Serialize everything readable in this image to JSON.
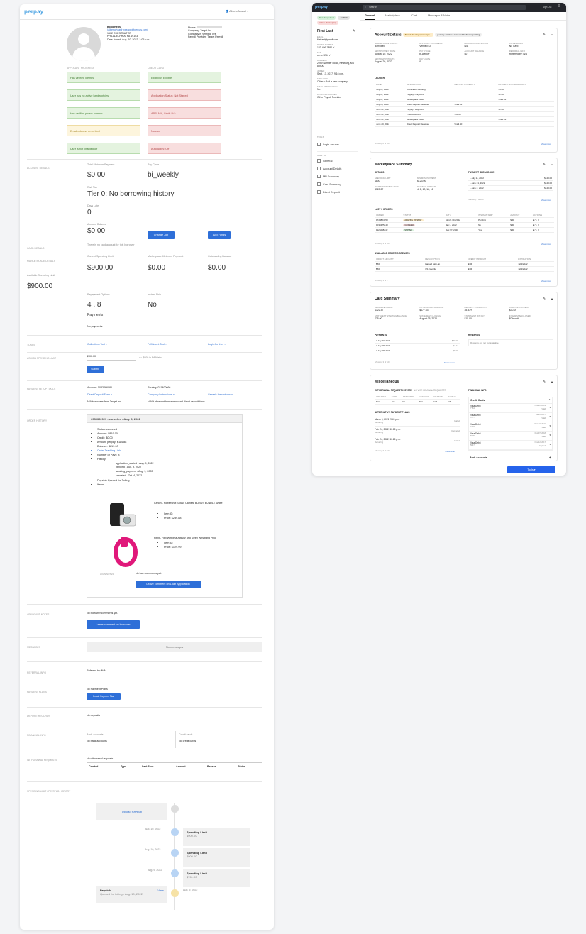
{
  "left": {
    "logo": "perpay",
    "user": "Alberto Amaral",
    "profile": {
      "name": "Bobo Reds",
      "email": "(alberto+card+preapp@perpay.com)",
      "address1": "1502 CHESTNUT ST",
      "address2": "PHILADELPHIA, PA 19103",
      "joined": "Date Joined: Aug. 10, 2022, 1:05 p.m.",
      "phone_label": "Phone:",
      "company": "Company: Target Inc",
      "company_verified": "Company is Verified: yes",
      "payroll": "Payroll Provider: Target Payroll"
    },
    "applicant_progress_label": "APPLICANT PROGRESS",
    "credit_card_label": "CREDIT CARD",
    "checks_left": [
      "Has verified identity",
      "User has no active bankruptcies",
      "Has verified phone number",
      "Email address unverified",
      "User is not charged off"
    ],
    "checks_right": [
      "Eligibility: Eligible",
      "Application Status: Not Started",
      "APR: N/A, Limit: N/A",
      "No card",
      "Auto Apply: Off"
    ],
    "account_details_label": "ACCOUNT DETAILS",
    "total_min_payment_label": "Total Minimum Payment",
    "total_min_payment": "$0.00",
    "pay_cycle_label": "Pay Cycle",
    "pay_cycle": "bi_weekly",
    "risk_tier_label": "Risk Tier",
    "risk_tier": "Tier 0: No borrowing history",
    "days_late_label": "Days Late",
    "days_late": "0",
    "account_balance_label": "Account Balance",
    "account_balance": "$0.00",
    "change_job": "Change Job",
    "add_funds": "Add Funds",
    "card_details_label": "CARD DETAILS",
    "card_details_text": "There is no card account for this borrower",
    "marketplace_label": "MARKETPLACE DETAILS",
    "available_spending_label": "Available Spending Limit",
    "available_spending": "$900.00",
    "current_spending_label": "Current Spending Limit",
    "current_spending": "$900.00",
    "mp_min_payment_label": "Marketplace Minimum Payment",
    "mp_min_payment": "$0.00",
    "outstanding_label": "Outstanding Balance",
    "outstanding": "$0.00",
    "repayment_label": "Repayment Options",
    "repayment": "4 , 8",
    "payments_label": "Payments",
    "instant_ship_label": "Instant Ship",
    "instant_ship": "No",
    "no_payments": "No payments.",
    "tools_label": "TOOLS",
    "tools": [
      "Collections Tool »",
      "Fulfillment Tool »",
      "Login As User »"
    ],
    "assign_limit_label": "ASSIGN SPENDING LIMIT",
    "limit_value": "$900.00",
    "limit_note": "<= $900 in PA/Idaho",
    "submit": "Submit",
    "payment_setup_label": "PAYMENT SETUP TOOLS",
    "account_no": "Account: 5083466086",
    "routing_no": "Routing: 021400666",
    "setup_links": [
      "Direct Deposit Form »",
      "Company Instructions »",
      "Generic Instructions »"
    ],
    "setup_note1": "N/A borrowers from Target Inc.",
    "setup_note2": "N/A% of recent borrowers used direct deposit form",
    "order_history_label": "ORDER HISTORY",
    "order": {
      "title": "#935352029 - canceled - Aug. 9, 2022",
      "lines": [
        "Status: canceled",
        "Amount: $819.00",
        "Credit: $0.00",
        "Amount perpay: $114.88",
        "Balance: $819.00"
      ],
      "link": "Order Tracking Link",
      "pays": "Number of Pays: 8",
      "history": "History:",
      "hist_items": [
        "application_started - Aug. 9, 2022",
        "pending - Aug. 9, 2022",
        "awaiting_payment - Aug. 9, 2022",
        "canceled - Oct. 4, 2022"
      ],
      "paystub": "Paystub Queued for Tolling",
      "items_label": "Items:",
      "item1": "Canon - PowerShot SX610 Camera BONUS BUNDLE White",
      "item1_id": "Item ID:",
      "item1_price": "Price: $289.88",
      "item2": "Fitbit - Flex Wireless Activity and Sleep Wristband Pink",
      "item2_id": "Item ID:",
      "item2_price": "Price: $129.99",
      "loan_notes_label": "LOAN NOTES",
      "loan_notes": "No loan comments yet.",
      "leave_loan": "Leave comment on Loan Application"
    },
    "applicant_notes_label": "APPLICANT NOTES",
    "applicant_notes": "No borrower comments yet.",
    "leave_borrower": "Leave comment on borrower",
    "messages_label": "MESSAGES",
    "no_messages": "No messages",
    "referral_label": "REFERRAL INFO",
    "referral": "Referred by: N/A",
    "payment_plans_label": "PAYMENT PLANS",
    "payment_plans": "No Payment Plans",
    "create_plan": "Create Payment Plan",
    "deposit_label": "DEPOSIT RECORDS",
    "deposits": "No deposits",
    "financial_label": "FINANCIAL INFO",
    "bank_accounts_label": "Bank accounts",
    "bank_accounts": "No bank accounts",
    "credit_cards_label": "Credit cards",
    "credit_cards": "No credit cards",
    "withdrawal_label": "WITHDRAWAL REQUESTS",
    "withdrawal": "No withdrawal requests",
    "wcols": [
      "Created",
      "Type",
      "Last Four",
      "Amount",
      "Reason",
      "Status"
    ],
    "history_label": "SPENDING LIMIT / PAYSTUB HISTORY",
    "upload_paystub": "Upload Paystub",
    "timeline": [
      {
        "date": "Aug. 10, 2022",
        "title": "Spending Limit",
        "value": "$900.00"
      },
      {
        "date": "Aug. 10, 2022",
        "title": "Spending Limit",
        "value": "$900.00"
      },
      {
        "date": "Aug. 9, 2022",
        "title": "Spending Limit",
        "value": "$761.00"
      }
    ],
    "paystub_card": {
      "title": "Paystub",
      "view": "View",
      "sub": "Queued for tolling - Aug. 10, 2022",
      "date": "Aug. 9, 2022"
    }
  },
  "right": {
    "logo": "perpay",
    "search": "Search",
    "signout": "Sign Out",
    "badges": [
      "Not charged off",
      "ACTIVE",
      "Active Bankruptcy"
    ],
    "name": "First Last",
    "side_fields": [
      {
        "label": "EMAIL",
        "value": "firstlast@gmail.com"
      },
      {
        "label": "PHONE NUMBER",
        "value": "123-456-7890 ✓"
      },
      {
        "label": "SSN",
        "value": "•••-••-1234 ✓"
      },
      {
        "label": "ADDRESS",
        "value": "2099 Number Road, Newburg, MD 85900"
      },
      {
        "label": "JOINED",
        "value": "Sept. 17, 2017, 9:16 p.m."
      },
      {
        "label": "EMPLOYER",
        "value": "Other > Add a new company"
      },
      {
        "label": "EMAIL VERIFICATION",
        "value": "No"
      },
      {
        "label": "PAYROLL PROVIDER",
        "value": "Other Payroll Provider"
      }
    ],
    "tools_label": "TOOLS",
    "login_user": "Login as user",
    "jump_label": "JUMP TO",
    "jump": [
      "General",
      "Account Details",
      "MP Summary",
      "Card Summary",
      "Direct Deposit"
    ],
    "tabs": [
      "General",
      "Marketplace",
      "Card",
      "Messages & Notes"
    ],
    "acct": {
      "title": "Account Details",
      "tier": "Tier 4: Good payer steps 1",
      "note": "perpay+ status: canceled before reporting",
      "fields": [
        [
          "MARKETPLACE STATUS",
          "Borrowed"
        ],
        [
          "APPLICANT PROGRESS",
          "Verified ID"
        ],
        [
          "BANK ACCOUNT STATUS",
          "N/A"
        ],
        [
          "CC REWARDS",
          "No Card"
        ],
        [
          "NEXT PAYMENT DATE",
          "August 10, 2022"
        ],
        [
          "PAY CYCLE",
          "bi-weekly"
        ],
        [
          "ACCOUNT BALANCE",
          "$0"
        ],
        [
          "REFERRAL INFO",
          "Referred by: N/A"
        ],
        [
          "NEXT DEPOSIT DATE",
          "August 20, 2022"
        ],
        [
          "DAYS LATE",
          "0"
        ]
      ],
      "ledger": "LEDGER",
      "lcols": [
        "DATE",
        "DESCRIPTION",
        "DEPOSITS/CREDITS",
        "PAYMENTS/WITHDRAWALS"
      ],
      "rows": [
        [
          "July 12, 2022",
          "Withdrawal Pending",
          "",
          "$3.00"
        ],
        [
          "July 11, 2022",
          "Paypay+ Payment",
          "",
          "$2.00"
        ],
        [
          "July 11, 2022",
          "Marketplace Order",
          "",
          "$123.92"
        ],
        [
          "July 10, 2022",
          "Direct Deposit Received",
          "$123.91",
          ""
        ],
        [
          "June 21, 2022",
          "Perpay+ Payment",
          "",
          "$2.00"
        ],
        [
          "June 21, 2022",
          "Product Refund",
          "$50.00",
          ""
        ],
        [
          "June 21, 2022",
          "Marketplace Order",
          "",
          "$123.63"
        ],
        [
          "June 20, 2022",
          "Direct Deposit Received",
          "$123.60",
          ""
        ]
      ],
      "showing": "Showing 8 of 100",
      "more": "Show more"
    },
    "mp": {
      "title": "Marketplace Summary",
      "details": "DETAILS",
      "fields": [
        [
          "SPENDING LIMIT",
          "$800"
        ],
        [
          "MINIMUM PAYMENT",
          "$123.00"
        ],
        [
          "OUTSTANDING BALANCE",
          "$328.27"
        ],
        [
          "PAYMENT OPTIONS",
          "4, 8, 12, 16, 18"
        ]
      ],
      "breakdown": "PAYMENT BREAKDOWN",
      "bd": [
        [
          "July 11, 2022",
          "$123.00"
        ],
        [
          "June 21, 2022",
          "$123.00"
        ],
        [
          "June 2, 2022",
          "$123.00"
        ]
      ],
      "bd_showing": "Showing 3 of 100",
      "bd_more": "Show more",
      "orders_label": "LAST 3 ORDERS",
      "ocols": [
        "ORDER",
        "STATUS",
        "DATE",
        "INSTANT SHIP",
        "AMOUNT",
        "ACTIONS"
      ],
      "orders": [
        [
          "1723824353",
          "AWAITING_PAYMENT",
          "March 30, 2022",
          "Pending",
          "$30"
        ],
        [
          "1036375443",
          "CANCELED",
          "Jan 6, 2022",
          "No",
          "$30"
        ],
        [
          "1125098442",
          "SHIPPED",
          "Dec 27, 2020",
          "Yes",
          "$30"
        ]
      ],
      "o_showing": "Showing 3 of 100",
      "o_more": "Show more",
      "credits_label": "AVAILABLE CREDIT/DISPENSES",
      "ccols": [
        "CREDIT AMOUNT",
        "DESCRIPTION",
        "CREDIT MINIMUM",
        "EXPIRATION"
      ],
      "credits": [
        [
          "$50",
          "Lapsed Sign-up",
          "$400",
          "12/3/2022"
        ],
        [
          "$50",
          "CS Favorite",
          "$400",
          "12/3/2022"
        ]
      ],
      "c_showing": "Showing 1 of 1",
      "c_more": "Show more"
    },
    "card": {
      "title": "Card Summary",
      "fields": [
        [
          "AVAILABLE CREDIT",
          "$322.37"
        ],
        [
          "OUTSTANDING BALANCE",
          "$177.63"
        ],
        [
          "PERCENT UTILIZATION",
          "35.53%"
        ],
        [
          "CARD MIN PAYMENT",
          "$30.00"
        ],
        [
          "STATEMENT STARTING BALANCE",
          "$25.00"
        ],
        [
          "STATEMENT CLOSING",
          "August 05, 2022"
        ],
        [
          "STATEMENT MIN PAY",
          "$15.00"
        ],
        [
          "INTEREST/ENCLOSED",
          "$0/month"
        ]
      ],
      "payments_label": "PAYMENTS",
      "payments": [
        [
          "July 20, 2022",
          "$50.00"
        ],
        [
          "July 18, 2022",
          "$4.12"
        ],
        [
          "July 18, 2022",
          "$8.00"
        ]
      ],
      "p_showing": "Showing 3 of 100",
      "p_more": "Show more",
      "rewards_label": "REWARDS",
      "rewards": "Rewards are not yet available."
    },
    "misc": {
      "title": "Miscellaneous",
      "wd": "WITHDRAWAL REQUEST HISTORY",
      "wd_sub": "· NO WITHDRAWAL REQUESTS",
      "wcols": [
        "CREATED",
        "TYPE",
        "LAST FOUR",
        "AMOUNT",
        "REASON",
        "STATUS"
      ],
      "wrow": [
        "N/A",
        "N/A",
        "N/A",
        "N/A",
        "N/A",
        "N/A"
      ],
      "alt": "ALTERNATIVE PAYMENT PLANS",
      "alts": [
        [
          "March 9, 2021, 9:45 p.m.",
          "Recurring",
          "Failed"
        ],
        [
          "Feb. 24, 2022, 10:15 p.m.",
          "Recurring",
          "Canceled"
        ],
        [
          "Feb. 24, 2022, 10:25 p.m.",
          "Recurring",
          "Failed"
        ]
      ],
      "a_showing": "Showing 3 of 100",
      "a_more": "Show More",
      "fin": "FINANCIAL INFO",
      "cc": "Credit Cards",
      "cards": [
        [
          "Visa Debit",
          "7764",
          "Nov 22, 2019",
          "Valid"
        ],
        [
          "Visa Debit",
          "5777",
          "Jul 26, 2017",
          "Valid"
        ],
        [
          "Visa Debit",
          "4403",
          "March 9, 2021",
          "Valid"
        ],
        [
          "Visa Debit",
          "6625",
          "Dec 07, 2018",
          "Valid"
        ],
        [
          "Visa Debit",
          "5647",
          "Nov 12, 2017",
          "Expired"
        ]
      ],
      "bank": "Bank Accounts"
    },
    "tools_btn": "Tools ▾"
  }
}
